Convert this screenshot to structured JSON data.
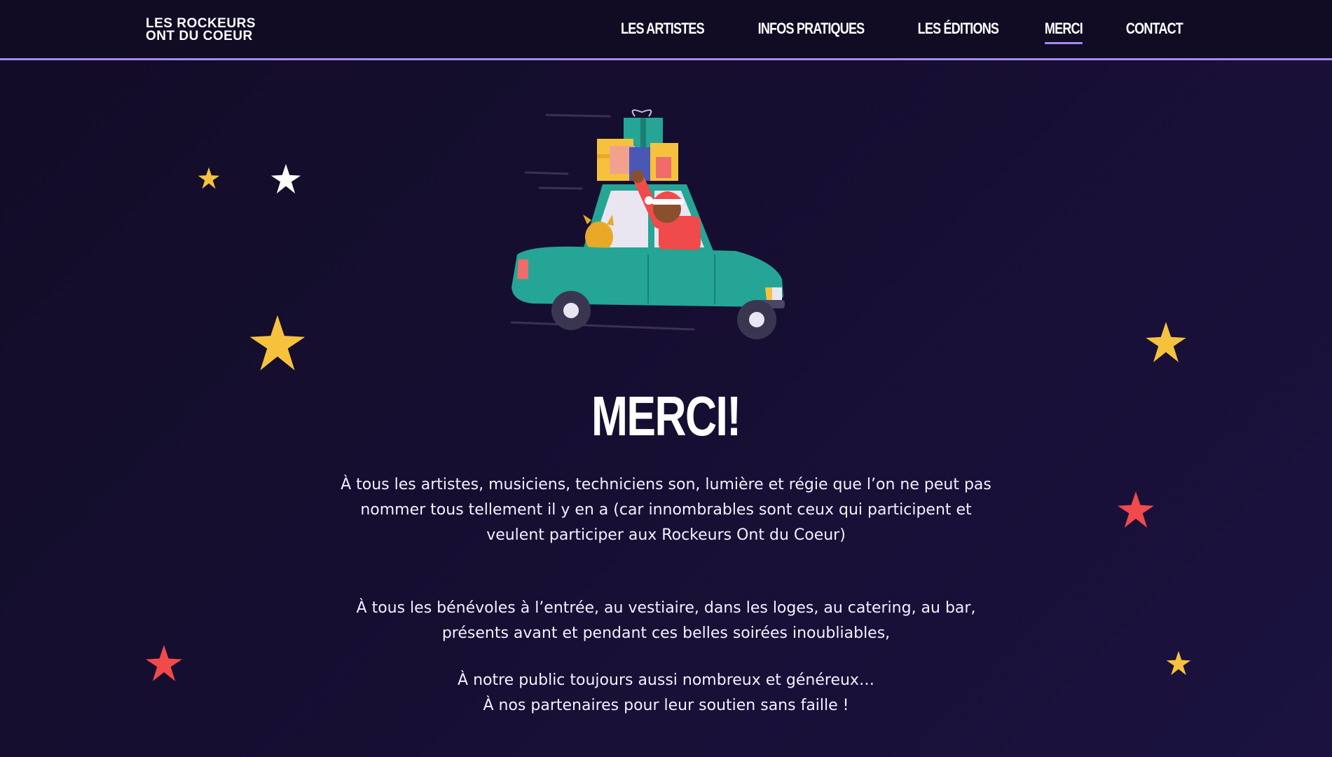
{
  "header": {
    "logo_line1": "LES ROCKEURS",
    "logo_line2": "ONT DU COEUR",
    "nav": [
      {
        "label": "LES ARTISTES",
        "active": false
      },
      {
        "label": "INFOS PRATIQUES",
        "active": false
      },
      {
        "label": "LES ÉDITIONS",
        "active": false
      },
      {
        "label": "MERCI",
        "active": true
      },
      {
        "label": "CONTACT",
        "active": false
      }
    ]
  },
  "main": {
    "title": "MERCI!",
    "paragraph1": "À tous les artistes, musiciens, techniciens son, lumière et régie que l’on ne peut pas nommer tous tellement il y en a (car innombrables sont ceux qui participent et veulent participer aux Rockeurs Ont du Coeur)",
    "paragraph2": "À tous les bénévoles à l’entrée, au vestiaire, dans les loges, au catering, au bar, présents avant et pendant ces belles soirées inoubliables,",
    "paragraph3_line1": "À notre public toujours aussi nombreux et généreux…",
    "paragraph3_line2": "À nos partenaires pour leur soutien sans faille !"
  },
  "colors": {
    "background": "#170f33",
    "header_background": "#110b24",
    "accent": "#a98bf0",
    "star_yellow": "#f6c23e",
    "star_red": "#f04a4a",
    "star_white": "#ffffff",
    "car_teal": "#25a596"
  },
  "icons": [
    "star-icon",
    "car-illustration"
  ]
}
